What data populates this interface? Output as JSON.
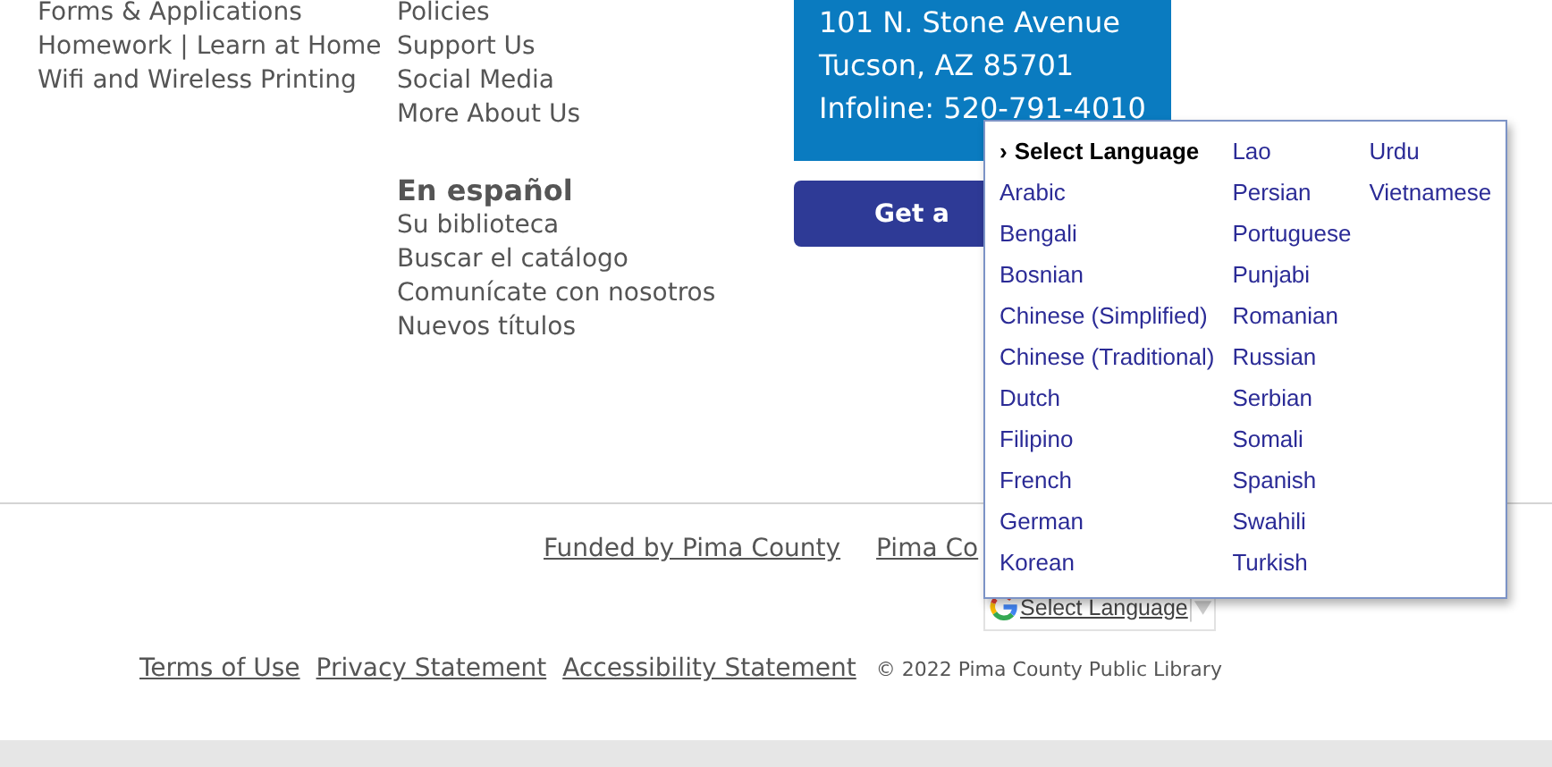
{
  "links_column_1": [
    "Forms & Applications",
    "Homework | Learn at Home",
    "Wifi and Wireless Printing"
  ],
  "links_column_2": [
    "Policies",
    "Support Us",
    "Social Media",
    "More About Us"
  ],
  "spanish_section": {
    "heading": "En español",
    "links": [
      "Su biblioteca",
      "Buscar el catálogo",
      "Comunícate con nosotros",
      "Nuevos títulos"
    ]
  },
  "address_box": {
    "lines": [
      "101 N. Stone Avenue",
      "Tucson, AZ 85701",
      "Infoline: 520-791-4010"
    ]
  },
  "cta_button": {
    "label": "Get a"
  },
  "footer_links_top": [
    "Funded by Pima County",
    "Pima Co"
  ],
  "translate_widget": {
    "label": "Select Language"
  },
  "footer_links_bottom": [
    "Terms of Use",
    "Privacy Statement",
    "Accessibility Statement"
  ],
  "copyright": "© 2022 Pima County Public Library",
  "language_menu": {
    "marker": "›",
    "header": "Select Language",
    "columns": [
      [
        "Arabic",
        "Bengali",
        "Bosnian",
        "Chinese (Simplified)",
        "Chinese (Traditional)",
        "Dutch",
        "Filipino",
        "French",
        "German",
        "Korean"
      ],
      [
        "Lao",
        "Persian",
        "Portuguese",
        "Punjabi",
        "Romanian",
        "Russian",
        "Serbian",
        "Somali",
        "Spanish",
        "Swahili",
        "Turkish"
      ],
      [
        "Urdu",
        "Vietnamese"
      ]
    ]
  }
}
